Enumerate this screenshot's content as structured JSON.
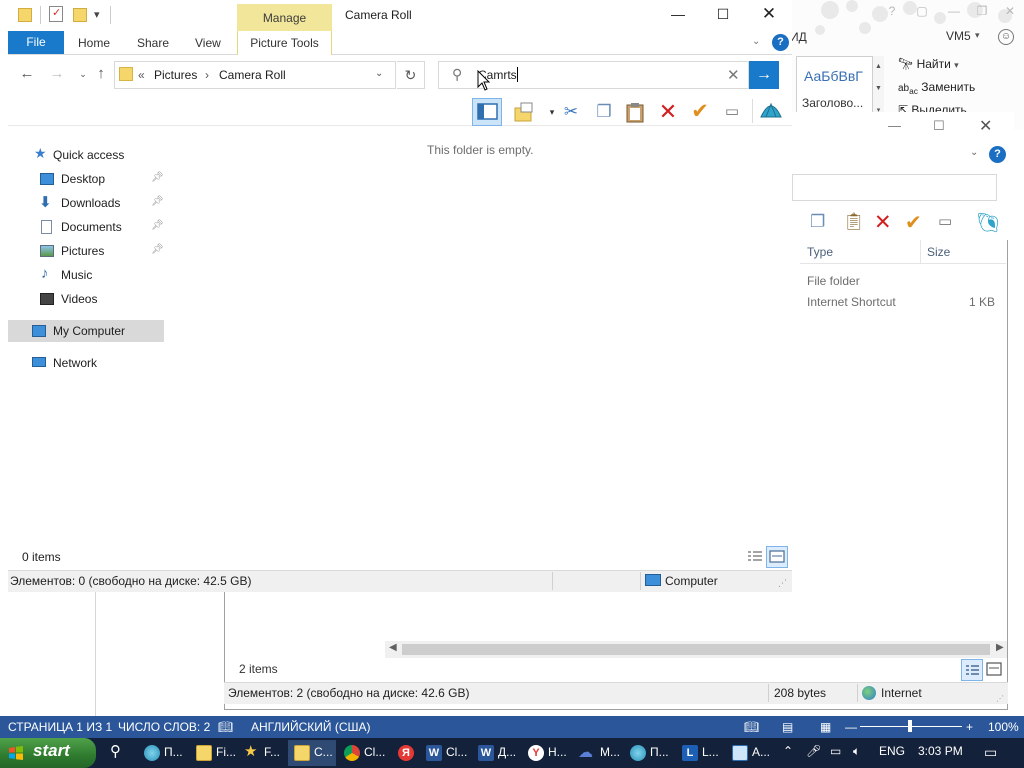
{
  "explorer": {
    "title": "Camera Roll",
    "manage_tab": "Manage",
    "ribbon_tabs": {
      "file": "File",
      "home": "Home",
      "share": "Share",
      "view": "View",
      "picture_tools": "Picture Tools"
    },
    "address": {
      "overflow": "«",
      "parts": [
        "Pictures",
        "Camera Roll"
      ],
      "separator": "›"
    },
    "search": {
      "value": "Camrts"
    },
    "empty_message": "This folder is empty.",
    "nav_pane": {
      "quick_access": "Quick access",
      "items": [
        {
          "label": "Desktop",
          "icon": "desktop-icon"
        },
        {
          "label": "Downloads",
          "icon": "downloads-icon"
        },
        {
          "label": "Documents",
          "icon": "documents-icon"
        },
        {
          "label": "Pictures",
          "icon": "pictures-icon"
        },
        {
          "label": "Music",
          "icon": "music-icon"
        },
        {
          "label": "Videos",
          "icon": "videos-icon"
        }
      ],
      "my_computer": "My Computer",
      "network": "Network"
    },
    "item_count": "0 items",
    "status": {
      "left": "Элементов: 0 (свободно на диске: 42.5 GB)",
      "location": "Computer"
    },
    "accent": "#1979ca",
    "manage_color": "#f1e69a"
  },
  "background_explorer": {
    "columns": {
      "type": "Type",
      "size": "Size"
    },
    "rows": [
      {
        "type": "File folder",
        "size": ""
      },
      {
        "type": "Internet Shortcut",
        "size": "1 KB"
      }
    ],
    "item_count": "2 items",
    "status": {
      "left": "Элементов: 2 (свободно на диске: 42.6 GB)",
      "bytes": "208 bytes",
      "zone": "Internet"
    }
  },
  "word": {
    "md_fragment": "ИД",
    "user": "VM5",
    "style_sample": "АаБбВвГ",
    "style_name": "Заголово...",
    "find": "Найти",
    "replace": "Заменить",
    "select": "Выделить",
    "status": {
      "page": "СТРАНИЦА 1 ИЗ 1",
      "words": "ЧИСЛО СЛОВ: 2",
      "language": "АНГЛИЙСКИЙ (США)",
      "zoom": "100%"
    },
    "accent": "#2b579a"
  },
  "taskbar": {
    "start": "start",
    "apps": [
      {
        "icon": "globe-icon",
        "label": "П..."
      },
      {
        "icon": "folder-icon",
        "label": "Fi..."
      },
      {
        "icon": "star-icon",
        "label": "F..."
      },
      {
        "icon": "folder-icon",
        "label": "C..."
      },
      {
        "icon": "chrome-icon",
        "label": "Cl..."
      },
      {
        "icon": "yandex-icon",
        "label": ""
      },
      {
        "icon": "word-icon",
        "label": "Cl..."
      },
      {
        "icon": "word-icon",
        "label": "Д..."
      },
      {
        "icon": "yandex-browser-icon",
        "label": "Н..."
      },
      {
        "icon": "cloud-icon",
        "label": "M..."
      },
      {
        "icon": "globe-icon",
        "label": "П..."
      },
      {
        "icon": "lync-icon",
        "label": "L..."
      },
      {
        "icon": "monitor-icon",
        "label": "A..."
      }
    ],
    "language": "ENG",
    "time": "3:03 PM"
  }
}
